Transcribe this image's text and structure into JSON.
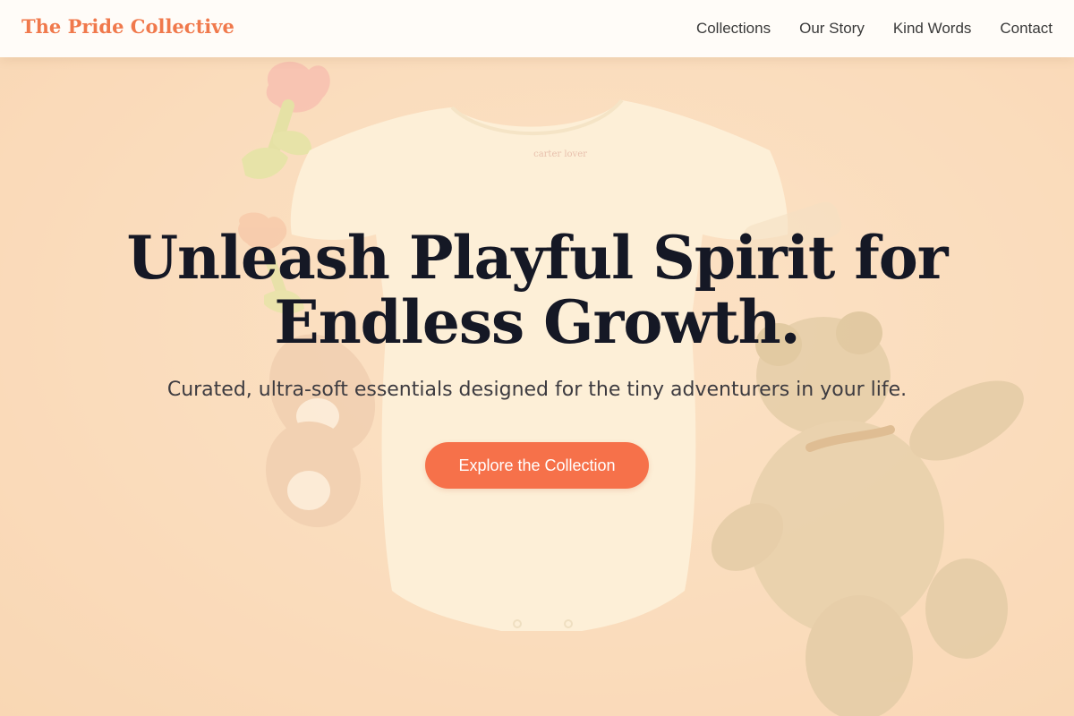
{
  "header": {
    "brand": "The Pride Collective",
    "nav": [
      {
        "label": "Collections"
      },
      {
        "label": "Our Story"
      },
      {
        "label": "Kind Words"
      },
      {
        "label": "Contact"
      }
    ]
  },
  "hero": {
    "title": "Unleash Playful Spirit for Endless Growth.",
    "subtitle": "Curated, ultra-soft essentials designed for the tiny adventurers in your life.",
    "cta_label": "Explore the Collection",
    "onesie_print": "carter lover"
  },
  "colors": {
    "brand": "#f0794c",
    "cta": "#f6714a",
    "title": "#151825",
    "background": "#f8d6b3"
  }
}
